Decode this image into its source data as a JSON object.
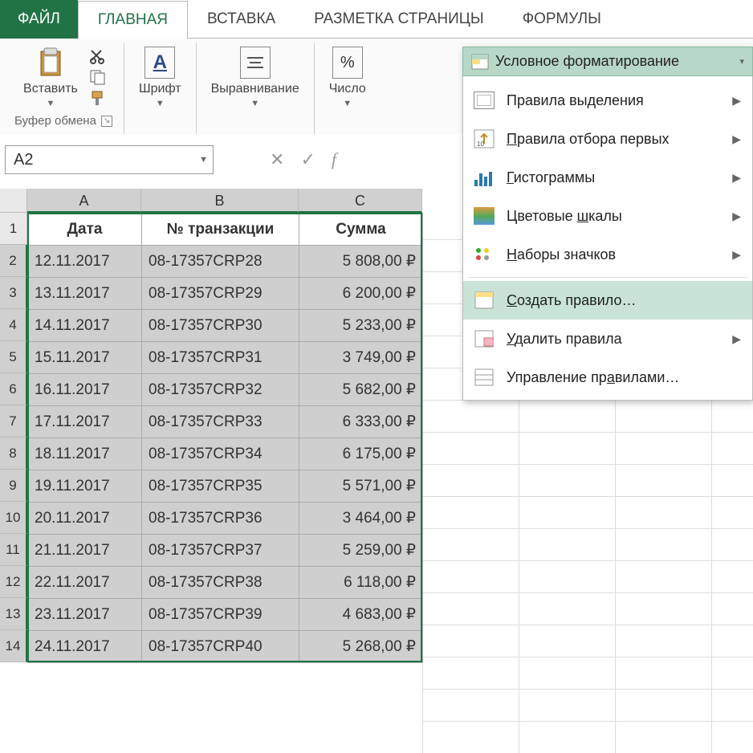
{
  "tabs": {
    "file": "ФАЙЛ",
    "home": "ГЛАВНАЯ",
    "insert": "ВСТАВКА",
    "layout": "РАЗМЕТКА СТРАНИЦЫ",
    "formulas": "ФОРМУЛЫ"
  },
  "ribbon": {
    "paste": "Вставить",
    "clipboard_caption": "Буфер обмена",
    "font": "Шрифт",
    "alignment": "Выравнивание",
    "number": "Число",
    "percent": "%",
    "letterA": "А"
  },
  "namebox": {
    "value": "A2",
    "fx": "f"
  },
  "table": {
    "colA_header": "A",
    "colB_header": "B",
    "colC_header": "C",
    "headers": {
      "a": "Дата",
      "b": "№ транзакции",
      "c": "Сумма"
    },
    "rows": [
      {
        "n": "1",
        "a": "Дата",
        "b": "№ транзакции",
        "c": "Сумма"
      },
      {
        "n": "2",
        "a": "12.11.2017",
        "b": "08-17357CRP28",
        "c": "5 808,00 ₽"
      },
      {
        "n": "3",
        "a": "13.11.2017",
        "b": "08-17357CRP29",
        "c": "6 200,00 ₽"
      },
      {
        "n": "4",
        "a": "14.11.2017",
        "b": "08-17357CRP30",
        "c": "5 233,00 ₽"
      },
      {
        "n": "5",
        "a": "15.11.2017",
        "b": "08-17357CRP31",
        "c": "3 749,00 ₽"
      },
      {
        "n": "6",
        "a": "16.11.2017",
        "b": "08-17357CRP32",
        "c": "5 682,00 ₽"
      },
      {
        "n": "7",
        "a": "17.11.2017",
        "b": "08-17357CRP33",
        "c": "6 333,00 ₽"
      },
      {
        "n": "8",
        "a": "18.11.2017",
        "b": "08-17357CRP34",
        "c": "6 175,00 ₽"
      },
      {
        "n": "9",
        "a": "19.11.2017",
        "b": "08-17357CRP35",
        "c": "5 571,00 ₽"
      },
      {
        "n": "10",
        "a": "20.11.2017",
        "b": "08-17357CRP36",
        "c": "3 464,00 ₽"
      },
      {
        "n": "11",
        "a": "21.11.2017",
        "b": "08-17357CRP37",
        "c": "5 259,00 ₽"
      },
      {
        "n": "12",
        "a": "22.11.2017",
        "b": "08-17357CRP38",
        "c": "6 118,00 ₽"
      },
      {
        "n": "13",
        "a": "23.11.2017",
        "b": "08-17357CRP39",
        "c": "4 683,00 ₽"
      },
      {
        "n": "14",
        "a": "24.11.2017",
        "b": "08-17357CRP40",
        "c": "5 268,00 ₽"
      }
    ]
  },
  "menu": {
    "title": "Условное форматирование",
    "highlight_rules": "Правила выделения",
    "top_bottom": "Правила отбора первых",
    "data_bars": "Гистограммы",
    "color_scales": "Цветовые шкалы",
    "icon_sets": "Наборы значков",
    "new_rule": "Создать правило…",
    "clear_rules": "Удалить правила",
    "manage_rules": "Управление правилами…"
  }
}
